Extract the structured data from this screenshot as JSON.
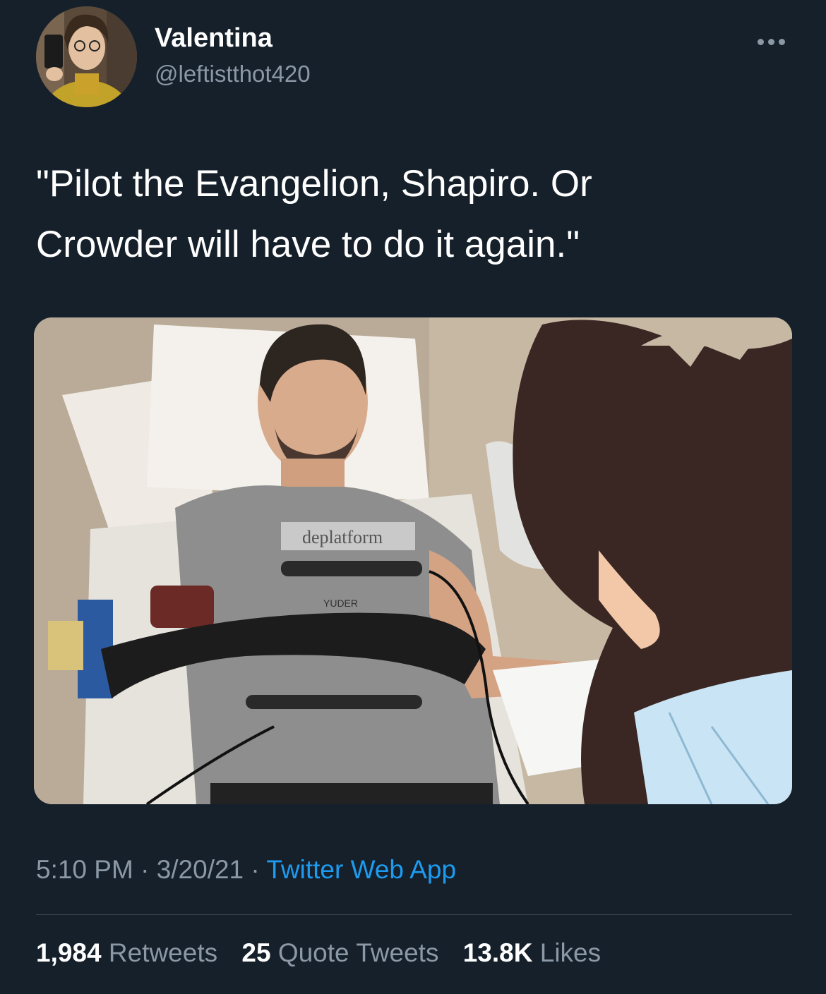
{
  "author": {
    "display_name": "Valentina",
    "handle": "@leftistthot420",
    "avatar_icon": "user-avatar"
  },
  "menu": {
    "icon": "more-horizontal-icon"
  },
  "tweet": {
    "text_line1": "\"Pilot the Evangelion, Shapiro. Or",
    "text_line2": "Crowder will have to do it again.\"",
    "image": {
      "shirt_text": "deplatform",
      "shirt_subtext": "YUDER"
    }
  },
  "meta": {
    "time": "5:10 PM",
    "sep1": " · ",
    "date": "3/20/21",
    "sep2": " · ",
    "source": "Twitter Web App"
  },
  "stats": {
    "retweets_count": "1,984",
    "retweets_label": "Retweets",
    "quotes_count": "25",
    "quotes_label": "Quote Tweets",
    "likes_count": "13.8K",
    "likes_label": "Likes"
  },
  "colors": {
    "background": "#15202b",
    "secondary_text": "#8b98a5",
    "link": "#1d9bf0",
    "divider": "#38444d"
  }
}
